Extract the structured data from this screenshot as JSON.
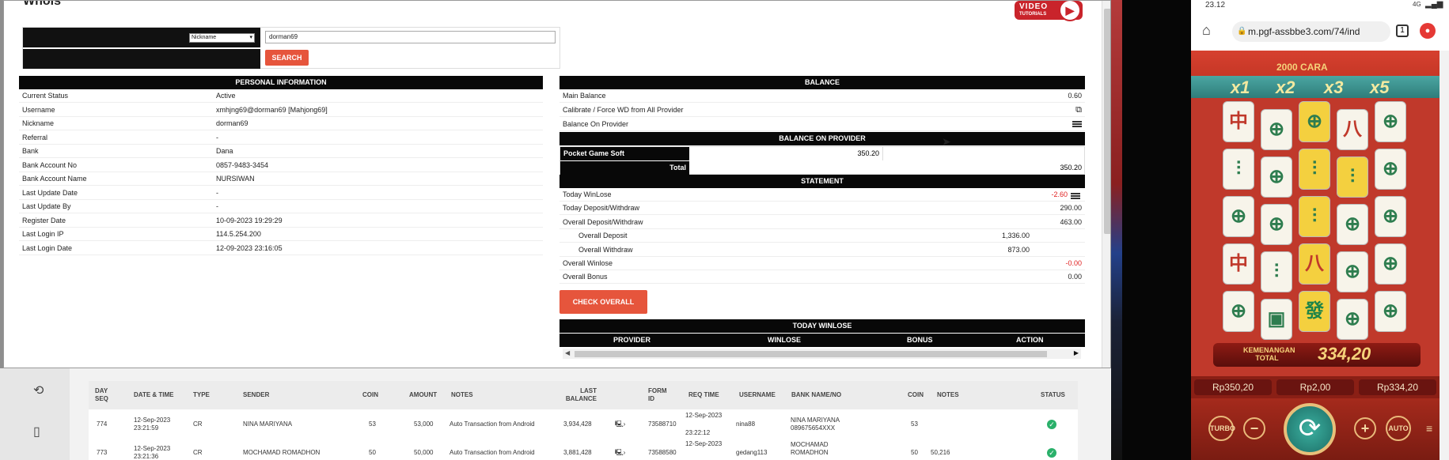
{
  "modal": {
    "title": "Whois",
    "video_logo": {
      "line1": "VIDEO",
      "line2": "TUTORIALS"
    },
    "search": {
      "field_select": "Nickname",
      "query": "dorman69",
      "button": "SEARCH"
    },
    "personal": {
      "header": "PERSONAL INFORMATION",
      "rows": [
        {
          "label": "Current Status",
          "value": "Active"
        },
        {
          "label": "Username",
          "value": "xmhjng69@dorman69  [Mahjong69]"
        },
        {
          "label": "Nickname",
          "value": "dorman69"
        },
        {
          "label": "Referral",
          "value": "-"
        },
        {
          "label": "Bank",
          "value": "Dana"
        },
        {
          "label": "Bank Account No",
          "value": "0857-9483-3454"
        },
        {
          "label": "Bank Account Name",
          "value": "NURSIWAN"
        },
        {
          "label": "Last Update Date",
          "value": "-"
        },
        {
          "label": "Last Update By",
          "value": "-"
        },
        {
          "label": "Register Date",
          "value": "10-09-2023 19:29:29"
        },
        {
          "label": "Last Login IP",
          "value": "114.5.254.200"
        },
        {
          "label": "Last Login Date",
          "value": "12-09-2023 23:16:05"
        }
      ]
    },
    "balance": {
      "header": "BALANCE",
      "main_label": "Main Balance",
      "main_value": "0.60",
      "calibrate_label": "Calibrate / Force WD from All Provider",
      "on_provider_label": "Balance On Provider"
    },
    "balance_on_provider": {
      "header": "BALANCE ON PROVIDER",
      "provider": "Pocket Game Soft",
      "provider_value": "350.20",
      "total_label": "Total",
      "total_value": "350.20"
    },
    "statement": {
      "header": "STATEMENT",
      "rows": [
        {
          "label": "Today WinLose",
          "value": "-2.60"
        },
        {
          "label": "Today Deposit/Withdraw",
          "value": "290.00"
        },
        {
          "label": "Overall Deposit/Withdraw",
          "value": "463.00"
        },
        {
          "label": "Overall Deposit",
          "value": "1,336.00"
        },
        {
          "label": "Overall Withdraw",
          "value": "873.00"
        },
        {
          "label": "Overall Winlose",
          "value": "-0.00"
        },
        {
          "label": "Overall Bonus",
          "value": "0.00"
        }
      ],
      "check_button": "CHECK OVERALL"
    },
    "today_winlose": {
      "header": "TODAY WINLOSE",
      "columns": [
        "PROVIDER",
        "WINLOSE",
        "BONUS",
        "ACTION"
      ]
    }
  },
  "back_table": {
    "headers": {
      "day_seq": "DAY SEQ",
      "date_time": "DATE & TIME",
      "type": "TYPE",
      "sender": "SENDER",
      "coin": "COIN",
      "amount": "AMOUNT",
      "notes": "NOTES",
      "last_balance": "LAST BALANCE",
      "form_id": "FORM ID",
      "req_time": "REQ TIME",
      "username": "USERNAME",
      "bank_name_no": "BANK NAME/NO",
      "coin2": "COIN",
      "notes2": "NOTES",
      "status": "STATUS"
    },
    "rows": [
      {
        "seq": "774",
        "date": "12-Sep-2023",
        "time": "23:21:59",
        "type": "CR",
        "sender": "NINA MARIYANA",
        "coin": "53",
        "amount": "53,000",
        "notes": "Auto Transaction from Android",
        "last_balance": "3,934,428",
        "form_id": "73588710",
        "req_date": "12-Sep-2023",
        "req_time": "23:22:12",
        "username": "nina88",
        "bank_name": "NINA MARIYANA",
        "bank_no": "089675654XXX",
        "coin2": "53",
        "notes2": ""
      },
      {
        "seq": "773",
        "date": "12-Sep-2023",
        "time": "23:21:36",
        "type": "CR",
        "sender": "MOCHAMAD ROMADHON",
        "coin": "50",
        "amount": "50,000",
        "notes": "Auto Transaction from Android",
        "last_balance": "3,881,428",
        "form_id": "73588580",
        "req_date": "12-Sep-2023",
        "req_time": "",
        "username": "gedang113",
        "bank_name": "MOCHAMAD ROMADHON",
        "bank_no": "",
        "coin2": "50",
        "notes2": "50,216"
      }
    ]
  },
  "phone": {
    "time": "23.12",
    "signal": "4G",
    "url": "m.pgf-assbbe3.com/74/ind",
    "tab_count": "1",
    "game": {
      "jackpot": "2000 CARA",
      "multipliers": [
        "x1",
        "x2",
        "x3",
        "x5"
      ],
      "win_label": "KEMENANGAN TOTAL",
      "win_value": "334,20",
      "bets": [
        "Rp350,20",
        "Rp2,00",
        "Rp334,20"
      ],
      "turbo": "TURBO",
      "auto": "AUTO"
    }
  },
  "colors": {
    "accent": "#e6553c",
    "negative": "#e02020",
    "header_bg": "#080808"
  },
  "icons": [
    "play-icon",
    "external-link-icon",
    "list-icon",
    "home-icon",
    "lock-icon",
    "history-icon",
    "book-icon",
    "monitor-icon",
    "check-icon",
    "spin-icon"
  ]
}
